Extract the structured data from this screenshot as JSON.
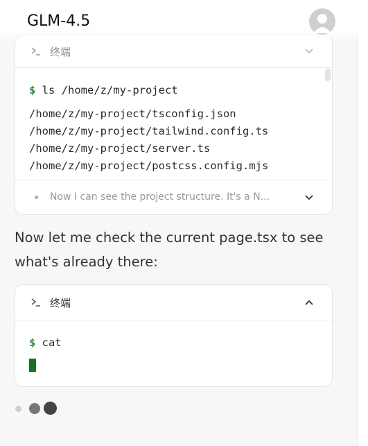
{
  "header": {
    "title": "GLM-4.5",
    "avatar_icon": "user-avatar-icon"
  },
  "terminal1": {
    "label": "终端",
    "command": "ls /home/z/my-project",
    "output": [
      "/home/z/my-project/tsconfig.json",
      "/home/z/my-project/tailwind.config.ts",
      "/home/z/my-project/server.ts",
      "/home/z/my-project/postcss.config.mjs"
    ],
    "summary": "Now I can see the project structure. It's a N..."
  },
  "message": {
    "text": "Now let me check the current page.tsx to see what's already there:"
  },
  "terminal2": {
    "label": "终端",
    "command": "cat"
  },
  "colors": {
    "prompt": "#2e8b3a",
    "cursor": "#1f6b2b"
  }
}
